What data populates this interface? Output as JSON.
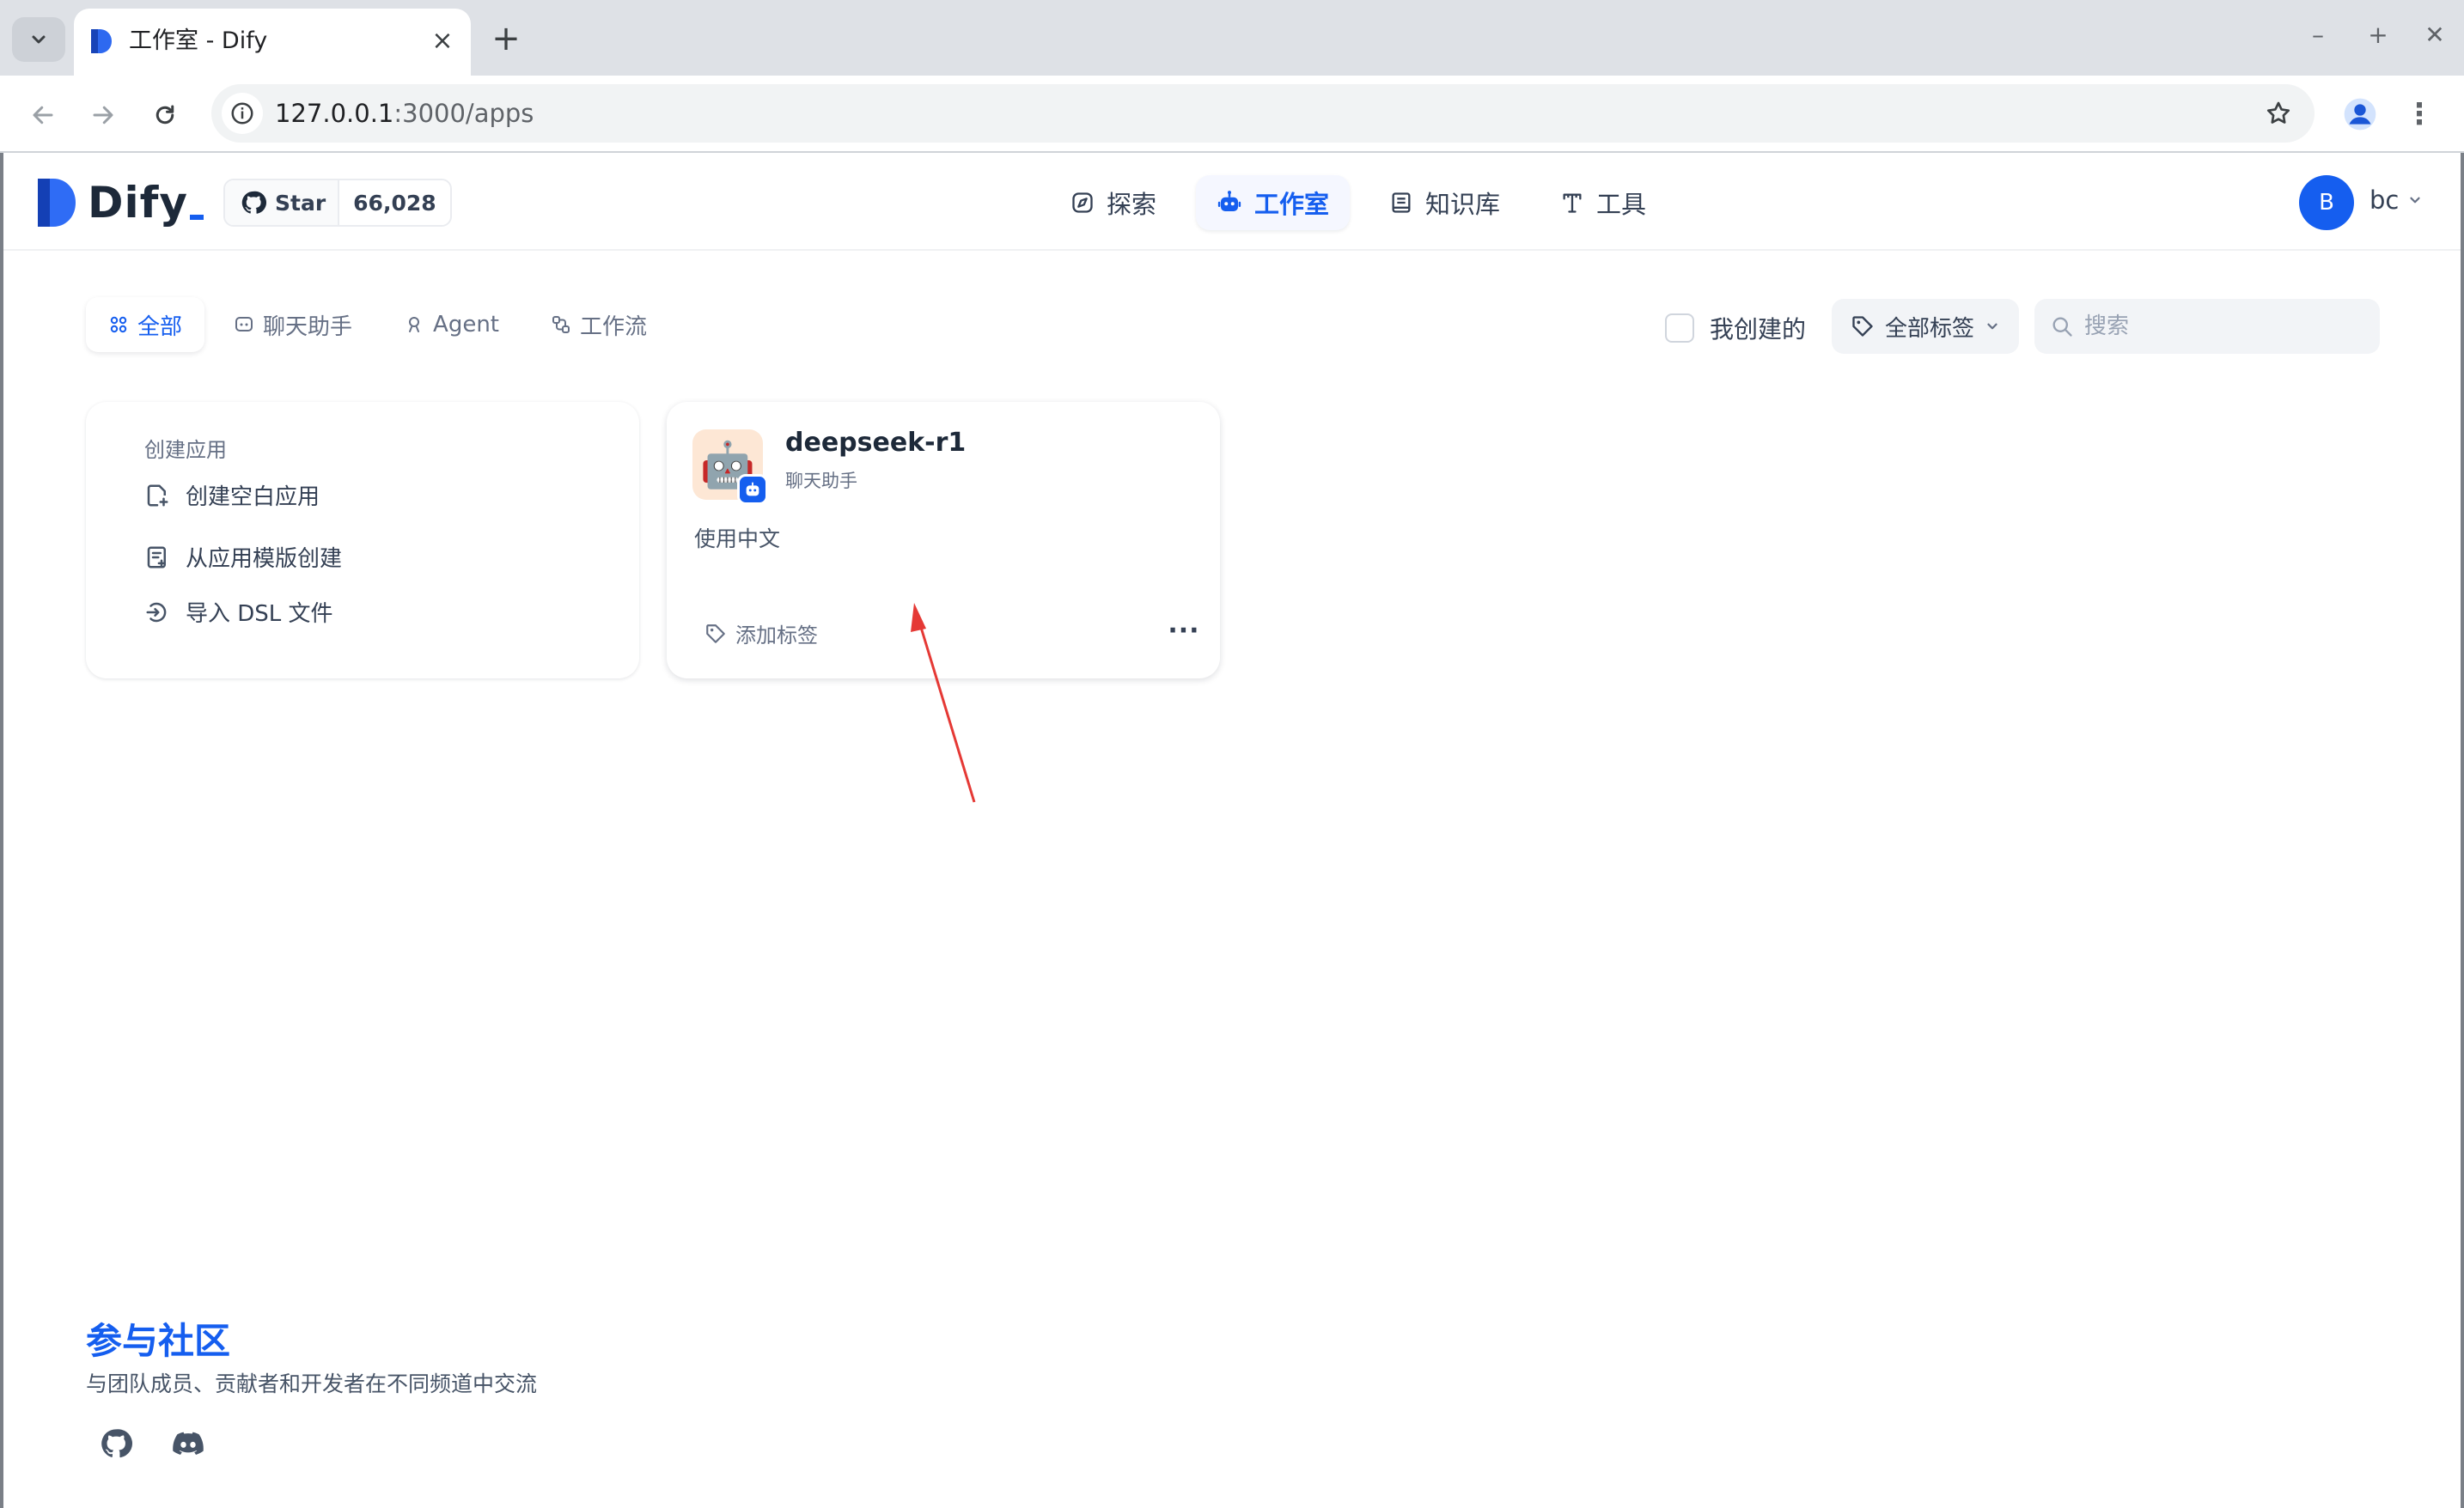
{
  "browser": {
    "tab_title": "工作室 - Dify",
    "url_host": "127.0.0.1",
    "url_rest": ":3000/apps",
    "window_controls": [
      "–",
      "+",
      "✕"
    ]
  },
  "header": {
    "logo_text": "Dify",
    "github": {
      "label": "Star",
      "count": "66,028"
    },
    "nav": [
      {
        "label": "探索",
        "icon": "explore-icon",
        "active": false
      },
      {
        "label": "工作室",
        "icon": "robot-icon",
        "active": true
      },
      {
        "label": "知识库",
        "icon": "book-icon",
        "active": false
      },
      {
        "label": "工具",
        "icon": "tools-icon",
        "active": false
      }
    ],
    "user": {
      "initial": "B",
      "name": "bc"
    }
  },
  "filters": {
    "tabs": [
      {
        "label": "全部",
        "icon": "grid-icon",
        "active": true
      },
      {
        "label": "聊天助手",
        "icon": "chat-icon",
        "active": false
      },
      {
        "label": "Agent",
        "icon": "agent-icon",
        "active": false
      },
      {
        "label": "工作流",
        "icon": "workflow-icon",
        "active": false
      }
    ],
    "mine_label": "我创建的",
    "tag_filter_label": "全部标签",
    "search_placeholder": "搜索"
  },
  "create_card": {
    "title": "创建应用",
    "options": [
      "创建空白应用",
      "从应用模版创建",
      "导入 DSL 文件"
    ]
  },
  "apps": [
    {
      "name": "deepseek-r1",
      "mode": "聊天助手",
      "description": "使用中文",
      "icon_emoji": "🤖",
      "add_tag_label": "添加标签",
      "more_label": "···"
    }
  ],
  "community": {
    "title": "参与社区",
    "subtitle": "与团队成员、贡献者和开发者在不同频道中交流",
    "links": [
      "github-icon",
      "discord-icon"
    ]
  },
  "colors": {
    "accent": "#155eef",
    "annotation_arrow": "#e53935"
  }
}
